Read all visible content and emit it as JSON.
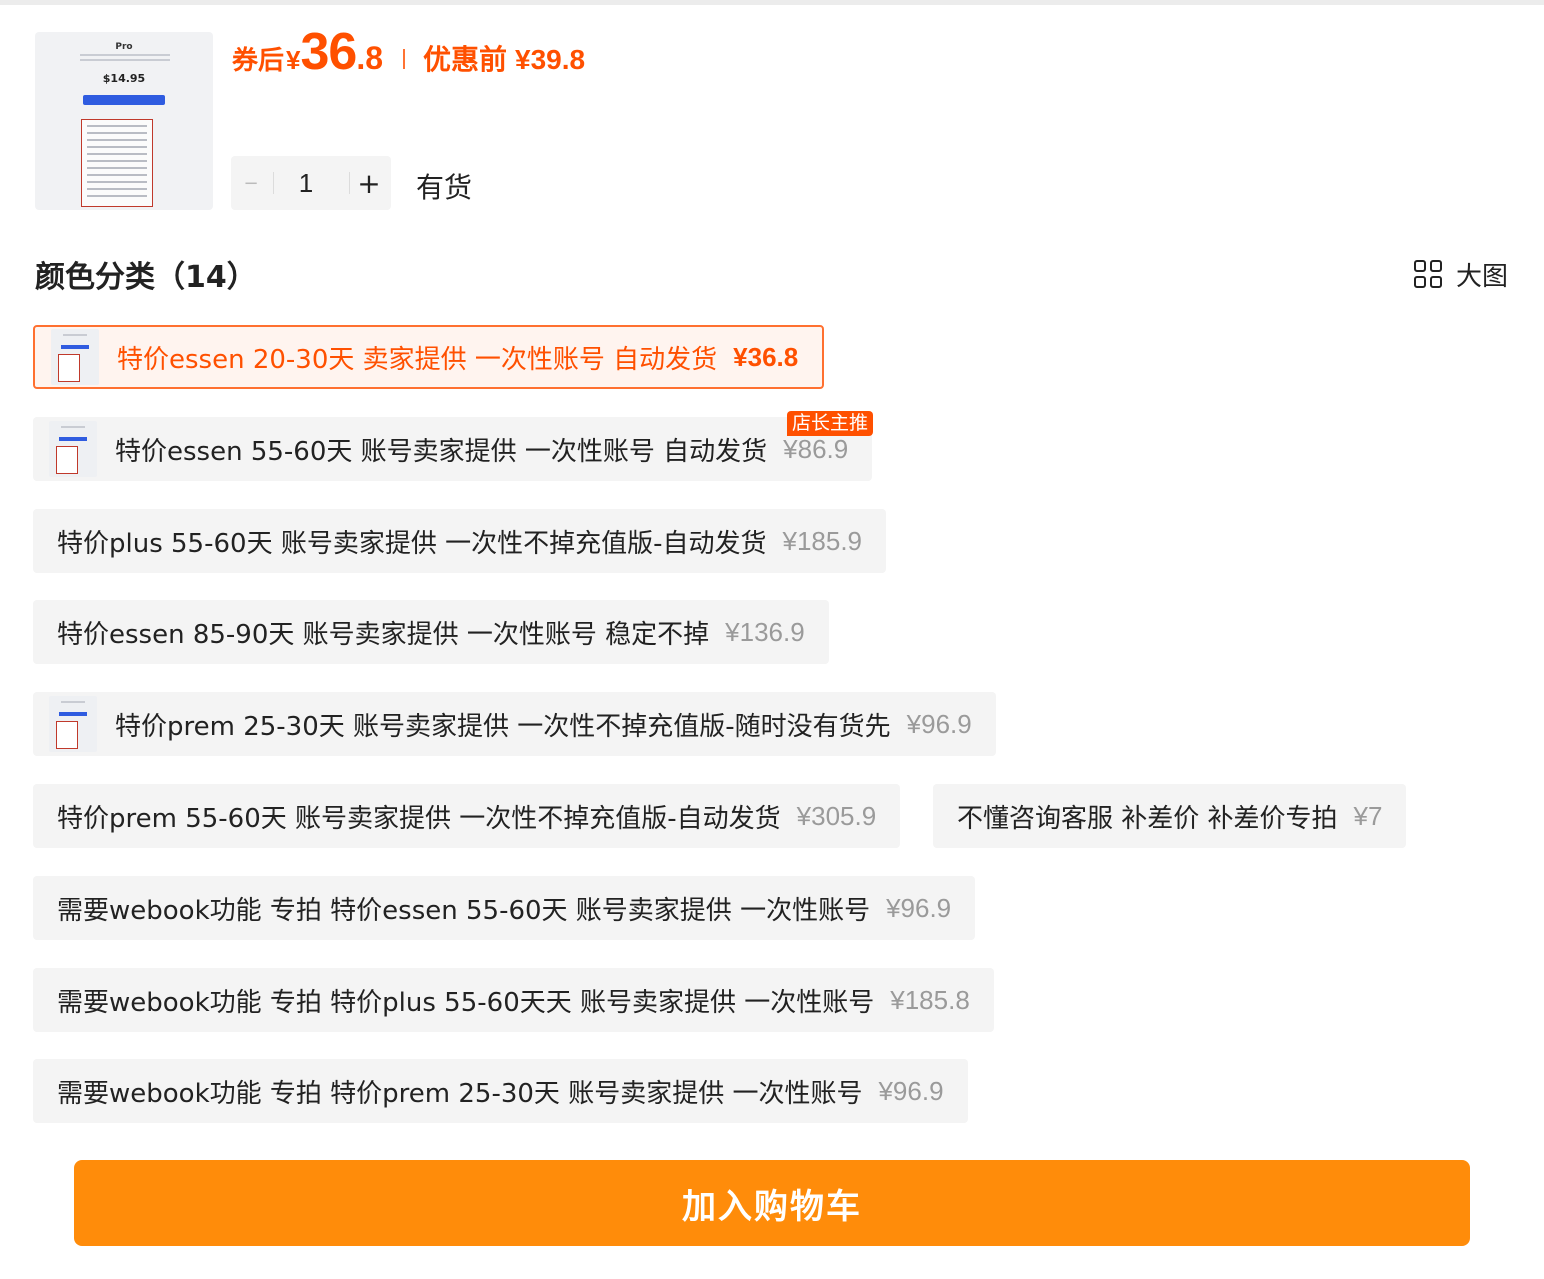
{
  "product": {
    "thumbnail": {
      "title": "Pro",
      "price": "$14.95"
    },
    "price": {
      "coupon_label": "券后",
      "currency": "¥",
      "integer": "36",
      "decimal": ".8",
      "original_label": "优惠前",
      "original_price": "¥39.8"
    },
    "quantity": {
      "minus": "−",
      "value": "1",
      "plus": "+"
    },
    "stock": "有货"
  },
  "variants": {
    "title": "颜色分类（14）",
    "big_view_label": "大图",
    "badge": "店长主推",
    "options": [
      {
        "label": "特价essen 20-30天 卖家提供 一次性账号 自动发货",
        "price": "¥36.8",
        "selected": true
      },
      {
        "label": "特价essen 55-60天 账号卖家提供 一次性账号 自动发货",
        "price": "¥86.9"
      },
      {
        "label": "特价plus 55-60天 账号卖家提供 一次性不掉充值版-自动发货",
        "price": "¥185.9"
      },
      {
        "label": "特价essen 85-90天 账号卖家提供 一次性账号 稳定不掉",
        "price": "¥136.9"
      },
      {
        "label": "特价prem 25-30天 账号卖家提供 一次性不掉充值版-随时没有货先",
        "price": "¥96.9"
      },
      {
        "label": "特价prem 55-60天 账号卖家提供 一次性不掉充值版-自动发货",
        "price": "¥305.9"
      },
      {
        "label": "不懂咨询客服 补差价 补差价专拍",
        "price": "¥7"
      },
      {
        "label": "需要webook功能 专拍 特价essen 55-60天 账号卖家提供 一次性账号",
        "price": "¥96.9"
      },
      {
        "label": "需要webook功能 专拍 特价plus 55-60天天 账号卖家提供 一次性账号",
        "price": "¥185.8"
      },
      {
        "label": "需要webook功能 专拍 特价prem 25-30天 账号卖家提供 一次性账号",
        "price": "¥96.9"
      }
    ]
  },
  "actions": {
    "add_to_cart": "加入购物车"
  },
  "colors": {
    "accent": "#ff5000",
    "cart_button": "#ff8c0a",
    "option_bg": "#f4f4f4"
  }
}
